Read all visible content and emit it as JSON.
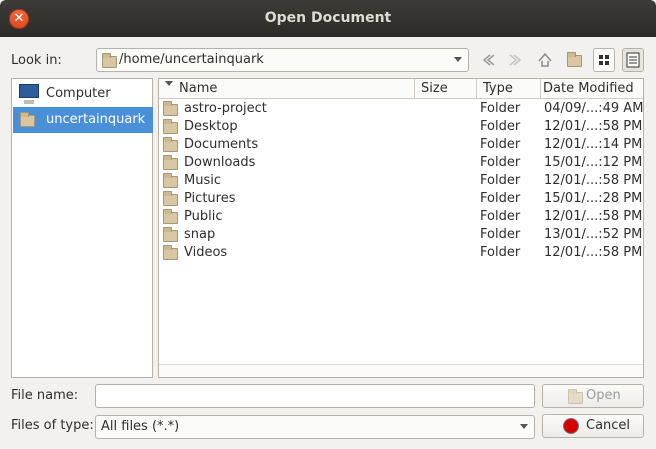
{
  "window": {
    "title": "Open Document"
  },
  "look_in": {
    "label": "Look in:",
    "path": "/home/uncertainquark"
  },
  "sidebar": {
    "places": [
      {
        "label": "Computer",
        "icon": "computer-icon"
      },
      {
        "label": "uncertainquark",
        "icon": "folder-icon",
        "selected": true
      }
    ]
  },
  "columns": {
    "name": "Name",
    "size": "Size",
    "type": "Type",
    "date": "Date Modified"
  },
  "files": [
    {
      "name": "astro-project",
      "size": "",
      "type": "Folder",
      "date": "04/09/...:49 AM"
    },
    {
      "name": "Desktop",
      "size": "",
      "type": "Folder",
      "date": "12/01/...:58 PM"
    },
    {
      "name": "Documents",
      "size": "",
      "type": "Folder",
      "date": "12/01/...:14 PM"
    },
    {
      "name": "Downloads",
      "size": "",
      "type": "Folder",
      "date": "15/01/...:12 PM"
    },
    {
      "name": "Music",
      "size": "",
      "type": "Folder",
      "date": "12/01/...:58 PM"
    },
    {
      "name": "Pictures",
      "size": "",
      "type": "Folder",
      "date": "15/01/...:28 PM"
    },
    {
      "name": "Public",
      "size": "",
      "type": "Folder",
      "date": "12/01/...:58 PM"
    },
    {
      "name": "snap",
      "size": "",
      "type": "Folder",
      "date": "13/01/...:52 PM"
    },
    {
      "name": "Videos",
      "size": "",
      "type": "Folder",
      "date": "12/01/...:58 PM"
    }
  ],
  "file_name": {
    "label": "File name:",
    "value": ""
  },
  "file_type": {
    "label": "Files of type:",
    "value": "All files (*.*)"
  },
  "buttons": {
    "open": "Open",
    "cancel": "Cancel"
  },
  "colors": {
    "selection": "#4a90d9",
    "titlebar": "#3c3b37",
    "close": "#e95420"
  }
}
